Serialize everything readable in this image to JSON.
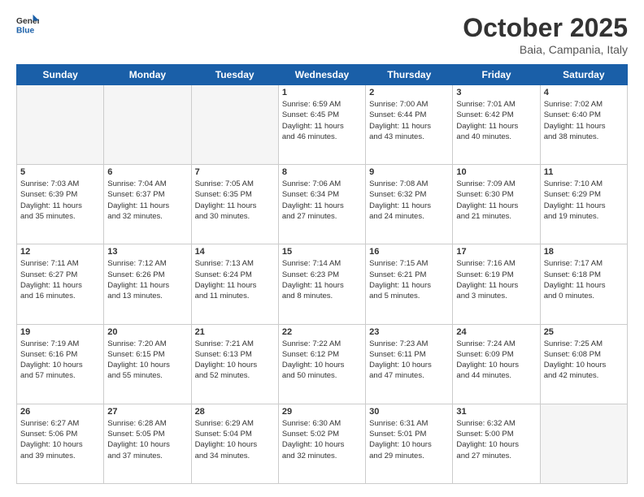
{
  "logo": {
    "general": "General",
    "blue": "Blue"
  },
  "title": "October 2025",
  "location": "Baia, Campania, Italy",
  "days_of_week": [
    "Sunday",
    "Monday",
    "Tuesday",
    "Wednesday",
    "Thursday",
    "Friday",
    "Saturday"
  ],
  "weeks": [
    [
      {
        "num": "",
        "info": ""
      },
      {
        "num": "",
        "info": ""
      },
      {
        "num": "",
        "info": ""
      },
      {
        "num": "1",
        "info": "Sunrise: 6:59 AM\nSunset: 6:45 PM\nDaylight: 11 hours\nand 46 minutes."
      },
      {
        "num": "2",
        "info": "Sunrise: 7:00 AM\nSunset: 6:44 PM\nDaylight: 11 hours\nand 43 minutes."
      },
      {
        "num": "3",
        "info": "Sunrise: 7:01 AM\nSunset: 6:42 PM\nDaylight: 11 hours\nand 40 minutes."
      },
      {
        "num": "4",
        "info": "Sunrise: 7:02 AM\nSunset: 6:40 PM\nDaylight: 11 hours\nand 38 minutes."
      }
    ],
    [
      {
        "num": "5",
        "info": "Sunrise: 7:03 AM\nSunset: 6:39 PM\nDaylight: 11 hours\nand 35 minutes."
      },
      {
        "num": "6",
        "info": "Sunrise: 7:04 AM\nSunset: 6:37 PM\nDaylight: 11 hours\nand 32 minutes."
      },
      {
        "num": "7",
        "info": "Sunrise: 7:05 AM\nSunset: 6:35 PM\nDaylight: 11 hours\nand 30 minutes."
      },
      {
        "num": "8",
        "info": "Sunrise: 7:06 AM\nSunset: 6:34 PM\nDaylight: 11 hours\nand 27 minutes."
      },
      {
        "num": "9",
        "info": "Sunrise: 7:08 AM\nSunset: 6:32 PM\nDaylight: 11 hours\nand 24 minutes."
      },
      {
        "num": "10",
        "info": "Sunrise: 7:09 AM\nSunset: 6:30 PM\nDaylight: 11 hours\nand 21 minutes."
      },
      {
        "num": "11",
        "info": "Sunrise: 7:10 AM\nSunset: 6:29 PM\nDaylight: 11 hours\nand 19 minutes."
      }
    ],
    [
      {
        "num": "12",
        "info": "Sunrise: 7:11 AM\nSunset: 6:27 PM\nDaylight: 11 hours\nand 16 minutes."
      },
      {
        "num": "13",
        "info": "Sunrise: 7:12 AM\nSunset: 6:26 PM\nDaylight: 11 hours\nand 13 minutes."
      },
      {
        "num": "14",
        "info": "Sunrise: 7:13 AM\nSunset: 6:24 PM\nDaylight: 11 hours\nand 11 minutes."
      },
      {
        "num": "15",
        "info": "Sunrise: 7:14 AM\nSunset: 6:23 PM\nDaylight: 11 hours\nand 8 minutes."
      },
      {
        "num": "16",
        "info": "Sunrise: 7:15 AM\nSunset: 6:21 PM\nDaylight: 11 hours\nand 5 minutes."
      },
      {
        "num": "17",
        "info": "Sunrise: 7:16 AM\nSunset: 6:19 PM\nDaylight: 11 hours\nand 3 minutes."
      },
      {
        "num": "18",
        "info": "Sunrise: 7:17 AM\nSunset: 6:18 PM\nDaylight: 11 hours\nand 0 minutes."
      }
    ],
    [
      {
        "num": "19",
        "info": "Sunrise: 7:19 AM\nSunset: 6:16 PM\nDaylight: 10 hours\nand 57 minutes."
      },
      {
        "num": "20",
        "info": "Sunrise: 7:20 AM\nSunset: 6:15 PM\nDaylight: 10 hours\nand 55 minutes."
      },
      {
        "num": "21",
        "info": "Sunrise: 7:21 AM\nSunset: 6:13 PM\nDaylight: 10 hours\nand 52 minutes."
      },
      {
        "num": "22",
        "info": "Sunrise: 7:22 AM\nSunset: 6:12 PM\nDaylight: 10 hours\nand 50 minutes."
      },
      {
        "num": "23",
        "info": "Sunrise: 7:23 AM\nSunset: 6:11 PM\nDaylight: 10 hours\nand 47 minutes."
      },
      {
        "num": "24",
        "info": "Sunrise: 7:24 AM\nSunset: 6:09 PM\nDaylight: 10 hours\nand 44 minutes."
      },
      {
        "num": "25",
        "info": "Sunrise: 7:25 AM\nSunset: 6:08 PM\nDaylight: 10 hours\nand 42 minutes."
      }
    ],
    [
      {
        "num": "26",
        "info": "Sunrise: 6:27 AM\nSunset: 5:06 PM\nDaylight: 10 hours\nand 39 minutes."
      },
      {
        "num": "27",
        "info": "Sunrise: 6:28 AM\nSunset: 5:05 PM\nDaylight: 10 hours\nand 37 minutes."
      },
      {
        "num": "28",
        "info": "Sunrise: 6:29 AM\nSunset: 5:04 PM\nDaylight: 10 hours\nand 34 minutes."
      },
      {
        "num": "29",
        "info": "Sunrise: 6:30 AM\nSunset: 5:02 PM\nDaylight: 10 hours\nand 32 minutes."
      },
      {
        "num": "30",
        "info": "Sunrise: 6:31 AM\nSunset: 5:01 PM\nDaylight: 10 hours\nand 29 minutes."
      },
      {
        "num": "31",
        "info": "Sunrise: 6:32 AM\nSunset: 5:00 PM\nDaylight: 10 hours\nand 27 minutes."
      },
      {
        "num": "",
        "info": ""
      }
    ]
  ]
}
